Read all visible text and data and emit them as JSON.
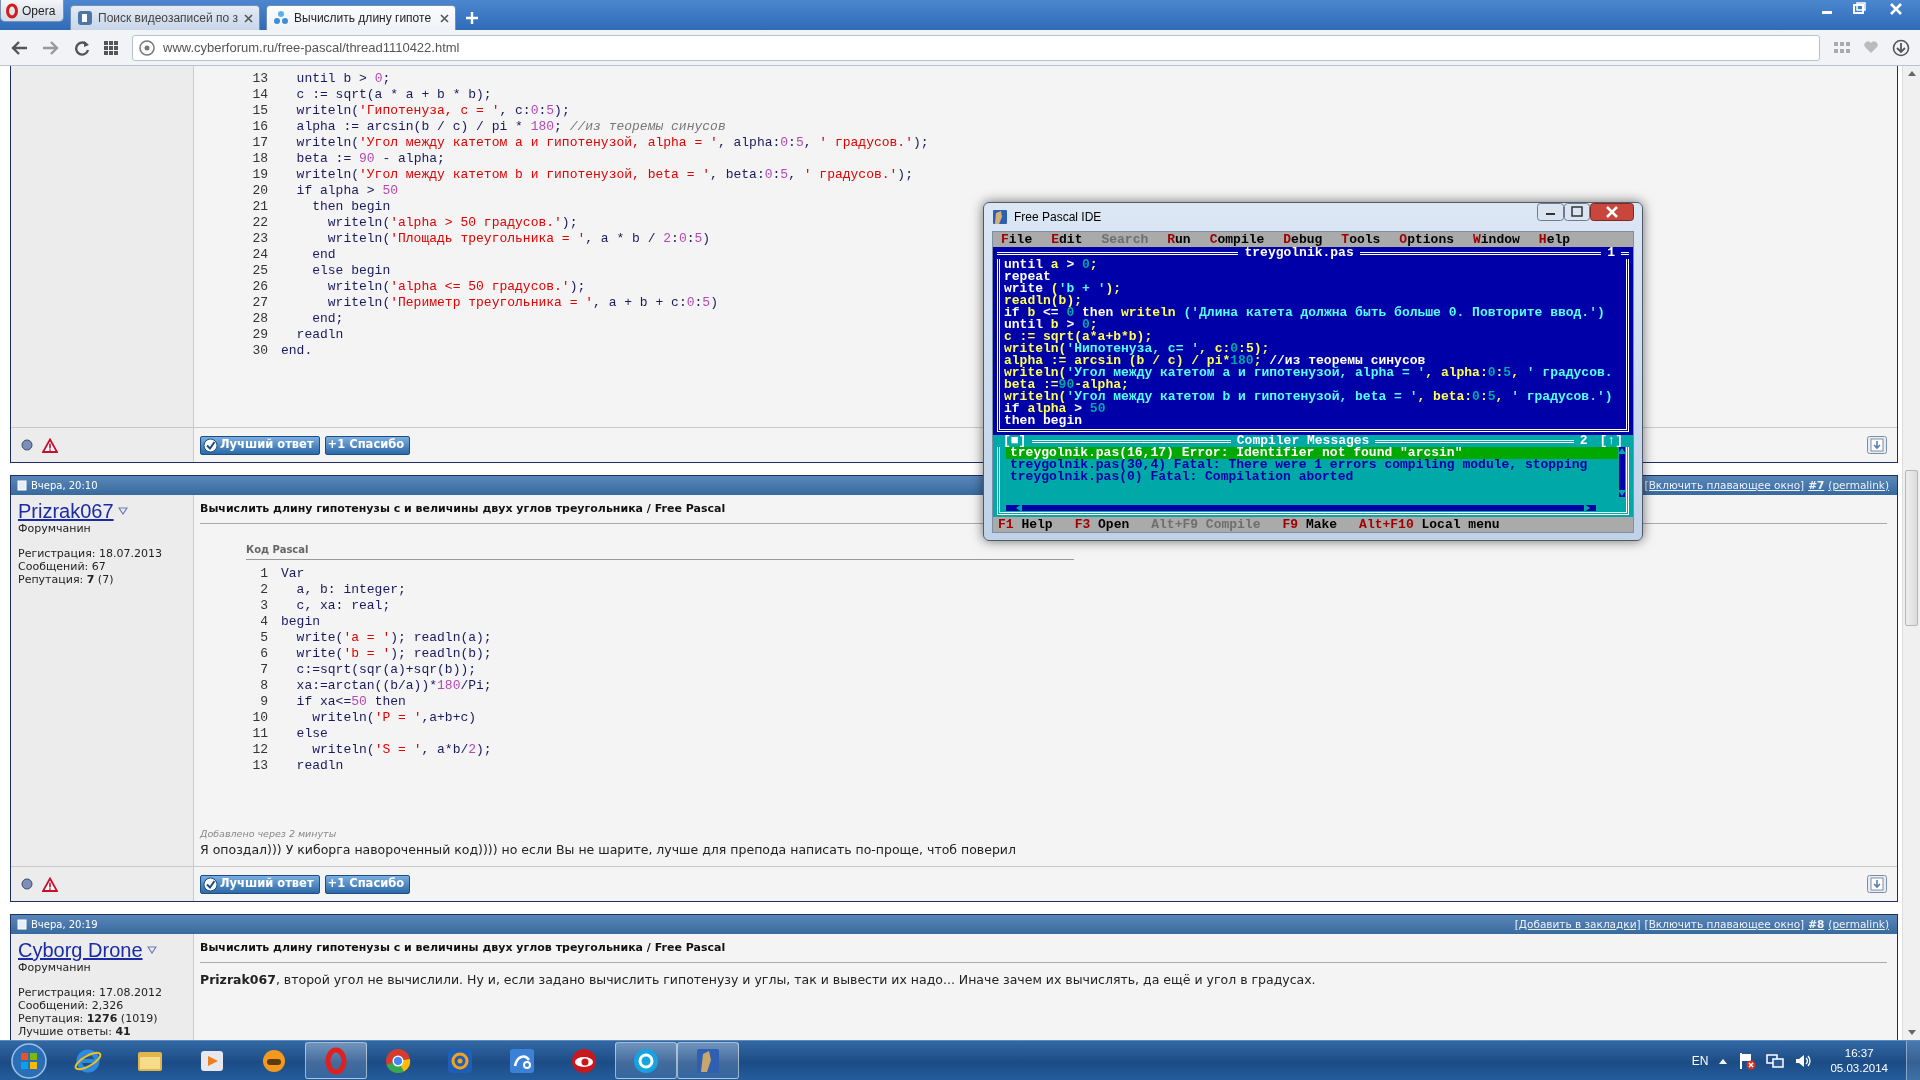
{
  "browser": {
    "menu_label": "Opera",
    "tabs": [
      {
        "kind": "square",
        "title": "Поиск видеозаписей по з",
        "selected": false
      },
      {
        "kind": "nodes",
        "title": "Вычислить длину гипоте",
        "selected": true
      }
    ],
    "url": "www.cyberforum.ru/free-pascal/thread1110422.html"
  },
  "posts": [
    {
      "code": {
        "lines": [
          {
            "number": "13",
            "tokens": [
              {
                "kind": "code",
                "text": "  until b > "
              },
              {
                "kind": "num",
                "text": "0"
              },
              {
                "kind": "code",
                "text": ";"
              }
            ]
          },
          {
            "number": "14",
            "tokens": [
              {
                "kind": "code",
                "text": "  c := sqrt(a * a + b * b);"
              }
            ]
          },
          {
            "number": "15",
            "tokens": [
              {
                "kind": "code",
                "text": "  writeln("
              },
              {
                "kind": "str",
                "text": "'Гипотенуза, c = '"
              },
              {
                "kind": "code",
                "text": ", c:"
              },
              {
                "kind": "num",
                "text": "0"
              },
              {
                "kind": "code",
                "text": ":"
              },
              {
                "kind": "num",
                "text": "5"
              },
              {
                "kind": "code",
                "text": ");"
              }
            ]
          },
          {
            "number": "16",
            "tokens": [
              {
                "kind": "code",
                "text": "  alpha := arcsin(b / c) / pi * "
              },
              {
                "kind": "num",
                "text": "180"
              },
              {
                "kind": "code",
                "text": "; "
              },
              {
                "kind": "cmt",
                "text": "//из теоремы синусов"
              }
            ]
          },
          {
            "number": "17",
            "tokens": [
              {
                "kind": "code",
                "text": "  writeln("
              },
              {
                "kind": "str",
                "text": "'Угол между катетом a и гипотенузой, alpha = '"
              },
              {
                "kind": "code",
                "text": ", alpha:"
              },
              {
                "kind": "num",
                "text": "0"
              },
              {
                "kind": "code",
                "text": ":"
              },
              {
                "kind": "num",
                "text": "5"
              },
              {
                "kind": "code",
                "text": ", "
              },
              {
                "kind": "str",
                "text": "' градусов.'"
              },
              {
                "kind": "code",
                "text": ");"
              }
            ]
          },
          {
            "number": "18",
            "tokens": [
              {
                "kind": "code",
                "text": "  beta := "
              },
              {
                "kind": "num",
                "text": "90"
              },
              {
                "kind": "code",
                "text": " - alpha;"
              }
            ]
          },
          {
            "number": "19",
            "tokens": [
              {
                "kind": "code",
                "text": "  writeln("
              },
              {
                "kind": "str",
                "text": "'Угол между катетом b и гипотенузой, beta = '"
              },
              {
                "kind": "code",
                "text": ", beta:"
              },
              {
                "kind": "num",
                "text": "0"
              },
              {
                "kind": "code",
                "text": ":"
              },
              {
                "kind": "num",
                "text": "5"
              },
              {
                "kind": "code",
                "text": ", "
              },
              {
                "kind": "str",
                "text": "' градусов.'"
              },
              {
                "kind": "code",
                "text": ");"
              }
            ]
          },
          {
            "number": "20",
            "tokens": [
              {
                "kind": "code",
                "text": "  if alpha > "
              },
              {
                "kind": "num",
                "text": "50"
              }
            ]
          },
          {
            "number": "21",
            "tokens": [
              {
                "kind": "code",
                "text": "    then begin"
              }
            ]
          },
          {
            "number": "22",
            "tokens": [
              {
                "kind": "code",
                "text": "      writeln("
              },
              {
                "kind": "str",
                "text": "'alpha > 50 градусов.'"
              },
              {
                "kind": "code",
                "text": ");"
              }
            ]
          },
          {
            "number": "23",
            "tokens": [
              {
                "kind": "code",
                "text": "      writeln("
              },
              {
                "kind": "str",
                "text": "'Площадь треугольника = '"
              },
              {
                "kind": "code",
                "text": ", a * b / "
              },
              {
                "kind": "num",
                "text": "2"
              },
              {
                "kind": "code",
                "text": ":"
              },
              {
                "kind": "num",
                "text": "0"
              },
              {
                "kind": "code",
                "text": ":"
              },
              {
                "kind": "num",
                "text": "5"
              },
              {
                "kind": "code",
                "text": ")"
              }
            ]
          },
          {
            "number": "24",
            "tokens": [
              {
                "kind": "code",
                "text": "    end"
              }
            ]
          },
          {
            "number": "25",
            "tokens": [
              {
                "kind": "code",
                "text": "    else begin"
              }
            ]
          },
          {
            "number": "26",
            "tokens": [
              {
                "kind": "code",
                "text": "      writeln("
              },
              {
                "kind": "str",
                "text": "'alpha <= 50 градусов.'"
              },
              {
                "kind": "code",
                "text": ");"
              }
            ]
          },
          {
            "number": "27",
            "tokens": [
              {
                "kind": "code",
                "text": "      writeln("
              },
              {
                "kind": "str",
                "text": "'Периметр треугольника = '"
              },
              {
                "kind": "code",
                "text": ", a + b + c:"
              },
              {
                "kind": "num",
                "text": "0"
              },
              {
                "kind": "code",
                "text": ":"
              },
              {
                "kind": "num",
                "text": "5"
              },
              {
                "kind": "code",
                "text": ")"
              }
            ]
          },
          {
            "number": "28",
            "tokens": [
              {
                "kind": "code",
                "text": "    end;"
              }
            ]
          },
          {
            "number": "29",
            "tokens": [
              {
                "kind": "code",
                "text": "  readln"
              }
            ]
          },
          {
            "number": "30",
            "tokens": [
              {
                "kind": "code",
                "text": "end."
              }
            ]
          }
        ]
      },
      "actions": [
        {
          "kind": "best",
          "label": "Лучший ответ"
        },
        {
          "kind": "thanks",
          "label": "+1 Спасибо"
        }
      ]
    },
    {
      "date": "Вчера, 20:10",
      "links": [
        {
          "kind": "link",
          "text": "[Включить плавающее окно]"
        },
        {
          "kind": "number",
          "text": "#7"
        },
        {
          "kind": "link",
          "text": "(permalink)"
        }
      ],
      "author": {
        "name": "Prizrak067",
        "role": "Форумчанин",
        "stats": [
          "Регистрация: 18.07.2013",
          "Сообщений: 67",
          "Репутация: **7** (7)"
        ]
      },
      "title": "Вычислить длину гипотенузы с и величины двух углов треугольника / Free Pascal",
      "code": {
        "label": "Код Pascal",
        "lines": [
          {
            "number": "1",
            "tokens": [
              {
                "kind": "code",
                "text": "Var"
              }
            ]
          },
          {
            "number": "2",
            "tokens": [
              {
                "kind": "code",
                "text": "  a, b: integer;"
              }
            ]
          },
          {
            "number": "3",
            "tokens": [
              {
                "kind": "code",
                "text": "  c, xa: real;"
              }
            ]
          },
          {
            "number": "4",
            "tokens": [
              {
                "kind": "code",
                "text": "begin"
              }
            ]
          },
          {
            "number": "5",
            "tokens": [
              {
                "kind": "code",
                "text": "  write("
              },
              {
                "kind": "str",
                "text": "'a = '"
              },
              {
                "kind": "code",
                "text": "); readln(a);"
              }
            ]
          },
          {
            "number": "6",
            "tokens": [
              {
                "kind": "code",
                "text": "  write("
              },
              {
                "kind": "str",
                "text": "'b = '"
              },
              {
                "kind": "code",
                "text": "); readln(b);"
              }
            ]
          },
          {
            "number": "7",
            "tokens": [
              {
                "kind": "code",
                "text": "  c:=sqrt(sqr(a)+sqr(b));"
              }
            ]
          },
          {
            "number": "8",
            "tokens": [
              {
                "kind": "code",
                "text": "  xa:=arctan((b/a))*"
              },
              {
                "kind": "num",
                "text": "180"
              },
              {
                "kind": "code",
                "text": "/Pi;"
              }
            ]
          },
          {
            "number": "9",
            "tokens": [
              {
                "kind": "code",
                "text": "  if xa<="
              },
              {
                "kind": "num",
                "text": "50"
              },
              {
                "kind": "code",
                "text": " then"
              }
            ]
          },
          {
            "number": "10",
            "tokens": [
              {
                "kind": "code",
                "text": "    writeln("
              },
              {
                "kind": "str",
                "text": "'P = '"
              },
              {
                "kind": "code",
                "text": ",a+b+c)"
              }
            ]
          },
          {
            "number": "11",
            "tokens": [
              {
                "kind": "code",
                "text": "  else"
              }
            ]
          },
          {
            "number": "12",
            "tokens": [
              {
                "kind": "code",
                "text": "    writeln("
              },
              {
                "kind": "str",
                "text": "'S = '"
              },
              {
                "kind": "code",
                "text": ", a*b/"
              },
              {
                "kind": "num",
                "text": "2"
              },
              {
                "kind": "code",
                "text": ");"
              }
            ]
          },
          {
            "number": "13",
            "tokens": [
              {
                "kind": "code",
                "text": "  readln"
              }
            ]
          }
        ]
      },
      "addendum": "Добавлено через 2 минуты",
      "message": "Я опоздал))) У киборга навороченный код)))) но если Вы не шарите, лучше для препода написать по-проще, чтоб поверил",
      "actions": [
        {
          "kind": "best",
          "label": "Лучший ответ"
        },
        {
          "kind": "thanks",
          "label": "+1 Спасибо"
        }
      ]
    },
    {
      "date": "Вчера, 20:19",
      "links": [
        {
          "kind": "link",
          "text": "[Добавить в закладки]"
        },
        {
          "kind": "link",
          "text": "[Включить плавающее окно]"
        },
        {
          "kind": "number",
          "text": "#8"
        },
        {
          "kind": "link",
          "text": "(permalink)"
        }
      ],
      "author": {
        "name": "Cyborg Drone",
        "role": "Форумчанин",
        "stats": [
          "Регистрация: 17.08.2012",
          "Сообщений: 2,326",
          "Репутация: **1276** (1019)",
          "Лучшие ответы: **41**"
        ]
      },
      "title": "Вычислить длину гипотенузы с и величины двух углов треугольника / Free Pascal",
      "message": "**Prizrak067**, второй угол не вычислили. Ну и, если задано вычислить гипотенузу и углы, так и вывести их надо... Иначе зачем их вычислять, да ещё и угол в градусах."
    }
  ],
  "ide": {
    "title": "Free Pascal IDE",
    "menu": [
      {
        "label": "File",
        "disabled": false
      },
      {
        "label": "Edit",
        "disabled": false
      },
      {
        "label": "Search",
        "disabled": true
      },
      {
        "label": "Run",
        "disabled": false
      },
      {
        "label": "Compile",
        "disabled": false
      },
      {
        "label": "Debug",
        "disabled": false
      },
      {
        "label": "Tools",
        "disabled": false
      },
      {
        "label": "Options",
        "disabled": false
      },
      {
        "label": "Window",
        "disabled": false
      },
      {
        "label": "Help",
        "disabled": false
      }
    ],
    "editor": {
      "file": "treygolnik.pas",
      "number": "1",
      "lines": [
        [
          {
            "kind": "kw",
            "text": "until "
          },
          {
            "kind": "id",
            "text": "a "
          },
          {
            "kind": "kw",
            "text": "> "
          },
          {
            "kind": "num",
            "text": "0"
          },
          {
            "kind": "id",
            "text": ";"
          }
        ],
        [
          {
            "kind": "kw",
            "text": "repeat"
          }
        ],
        [
          {
            "kind": "kw",
            "text": "write "
          },
          {
            "kind": "id",
            "text": "("
          },
          {
            "kind": "str",
            "text": "'b + '"
          },
          {
            "kind": "id",
            "text": ");"
          }
        ],
        [
          {
            "kind": "id",
            "text": "readln(b);"
          }
        ],
        [
          {
            "kind": "kw",
            "text": "if "
          },
          {
            "kind": "id",
            "text": "b "
          },
          {
            "kind": "kw",
            "text": "<= "
          },
          {
            "kind": "num",
            "text": "0"
          },
          {
            "kind": "kw",
            "text": " then "
          },
          {
            "kind": "id",
            "text": "writeln "
          },
          {
            "kind": "str",
            "text": "('Длина катета должна быть больше 0. Повторите ввод.')"
          }
        ],
        [
          {
            "kind": "kw",
            "text": "until "
          },
          {
            "kind": "id",
            "text": "b "
          },
          {
            "kind": "kw",
            "text": "> "
          },
          {
            "kind": "num",
            "text": "0"
          },
          {
            "kind": "id",
            "text": ";"
          }
        ],
        [
          {
            "kind": "id",
            "text": "c := sqrt(a*a+b*b);"
          }
        ],
        [
          {
            "kind": "id",
            "text": "writeln("
          },
          {
            "kind": "str",
            "text": "'Нипотенуза, c= '"
          },
          {
            "kind": "id",
            "text": ", c:"
          },
          {
            "kind": "num",
            "text": "0"
          },
          {
            "kind": "id",
            "text": ":5);"
          }
        ],
        [
          {
            "kind": "id",
            "text": "alpha := arcsin (b / c) / pi*"
          },
          {
            "kind": "num",
            "text": "180"
          },
          {
            "kind": "id",
            "text": "; "
          },
          {
            "kind": "cmt",
            "text": "//из теоремы синусов"
          }
        ],
        [
          {
            "kind": "id",
            "text": "writeln("
          },
          {
            "kind": "str",
            "text": "'Угол между катетом a и гипотенузой, alpha = '"
          },
          {
            "kind": "id",
            "text": ", alpha:"
          },
          {
            "kind": "num",
            "text": "0"
          },
          {
            "kind": "id",
            "text": ":"
          },
          {
            "kind": "num",
            "text": "5"
          },
          {
            "kind": "id",
            "text": ", "
          },
          {
            "kind": "str",
            "text": "' градусов."
          }
        ],
        [
          {
            "kind": "id",
            "text": "beta :="
          },
          {
            "kind": "num",
            "text": "90"
          },
          {
            "kind": "id",
            "text": "-alpha;"
          }
        ],
        [
          {
            "kind": "id",
            "text": "writeln("
          },
          {
            "kind": "str",
            "text": "'Угол между катетом b и гипотенузой, beta = '"
          },
          {
            "kind": "id",
            "text": ", beta:"
          },
          {
            "kind": "num",
            "text": "0"
          },
          {
            "kind": "id",
            "text": ":"
          },
          {
            "kind": "num",
            "text": "5"
          },
          {
            "kind": "id",
            "text": ", "
          },
          {
            "kind": "str",
            "text": "' градусов.')"
          }
        ],
        [
          {
            "kind": "kw",
            "text": "if "
          },
          {
            "kind": "id",
            "text": "alpha "
          },
          {
            "kind": "kw",
            "text": "> "
          },
          {
            "kind": "num",
            "text": "50"
          }
        ],
        [
          {
            "kind": "kw",
            "text": "then begin"
          }
        ]
      ]
    },
    "messages": {
      "close_box": "[■]",
      "title": "Compiler Messages",
      "number": "2",
      "zoom_box": "[↑]",
      "lines": [
        {
          "text": "treygolnik.pas(16,17) Error: Identifier not found \"arcsin\"",
          "selected": true
        },
        {
          "text": "treygolnik.pas(30,4) Fatal: There were 1 errors compiling module, stopping",
          "selected": false
        },
        {
          "text": "treygolnik.pas(0) Fatal: Compilation aborted",
          "selected": false
        }
      ]
    },
    "status": [
      {
        "key": "F1",
        "label": "Help",
        "disabled": false
      },
      {
        "key": "F3",
        "label": "Open",
        "disabled": false
      },
      {
        "key": "Alt+F9",
        "label": "Compile",
        "disabled": true
      },
      {
        "key": "F9",
        "label": "Make",
        "disabled": false
      },
      {
        "key": "Alt+F10",
        "label": "Local menu",
        "disabled": false
      }
    ]
  },
  "taskbar": {
    "apps": [
      {
        "kind": "ie",
        "open": false
      },
      {
        "kind": "folder",
        "open": false
      },
      {
        "kind": "media",
        "open": false
      },
      {
        "kind": "game",
        "open": false
      },
      {
        "kind": "opera",
        "open": true
      },
      {
        "kind": "chrome",
        "open": false
      },
      {
        "kind": "mail",
        "open": false
      },
      {
        "kind": "rabbit",
        "open": false
      },
      {
        "kind": "camera",
        "open": false
      },
      {
        "kind": "skype",
        "open": true
      },
      {
        "kind": "fpc",
        "open": true
      }
    ],
    "language": "EN",
    "time": "16:37",
    "date": "05.03.2014"
  }
}
